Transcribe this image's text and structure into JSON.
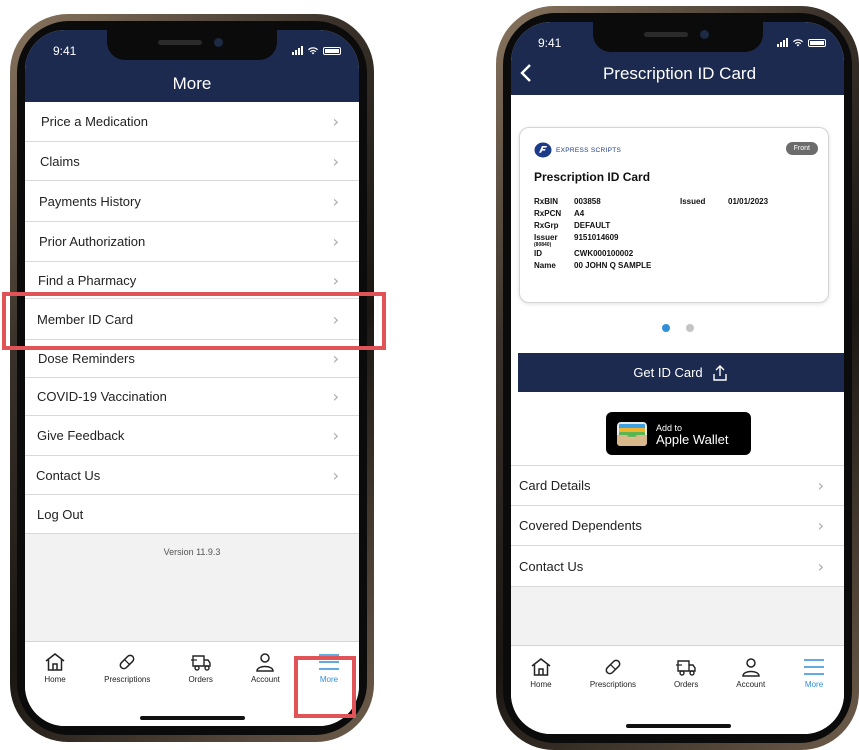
{
  "colors": {
    "navy": "#1b2a4e",
    "accent_blue": "#2f8fd9",
    "highlight_red": "#e05457"
  },
  "left_phone": {
    "time": "9:41",
    "title": "More",
    "menu_items": [
      {
        "label": "Price a Medication"
      },
      {
        "label": "Claims"
      },
      {
        "label": "Payments History"
      },
      {
        "label": "Prior Authorization"
      },
      {
        "label": "Find a Pharmacy"
      },
      {
        "label": "Member ID Card"
      },
      {
        "label": "Dose Reminders"
      },
      {
        "label": "COVID-19 Vaccination"
      },
      {
        "label": "Give Feedback"
      },
      {
        "label": "Contact Us"
      },
      {
        "label": "Log Out"
      }
    ],
    "version": "Version 11.9.3"
  },
  "right_phone": {
    "time": "9:41",
    "title": "Prescription ID Card",
    "card": {
      "brand": "EXPRESS SCRIPTS",
      "side_badge": "Front",
      "heading": "Prescription ID Card",
      "rxbin_label": "RxBIN",
      "rxbin_value": "003858",
      "issued_label": "Issued",
      "issued_value": "01/01/2023",
      "rxpcn_label": "RxPCN",
      "rxpcn_value": "A4",
      "rxgrp_label": "RxGrp",
      "rxgrp_value": "DEFAULT",
      "issuer_label": "Issuer",
      "issuer_sub": "(80840)",
      "issuer_value": "9151014609",
      "id_label": "ID",
      "id_value": "CWK000100002",
      "name_label": "Name",
      "name_value": "00 JOHN Q SAMPLE"
    },
    "get_id_card": "Get ID Card",
    "wallet_line1": "Add to",
    "wallet_line2": "Apple Wallet",
    "list": [
      {
        "label": "Card Details"
      },
      {
        "label": "Covered Dependents"
      },
      {
        "label": "Contact Us"
      }
    ]
  },
  "tabs": [
    {
      "label": "Home",
      "icon": "home-icon"
    },
    {
      "label": "Prescriptions",
      "icon": "pill-icon"
    },
    {
      "label": "Orders",
      "icon": "truck-icon"
    },
    {
      "label": "Account",
      "icon": "person-icon"
    },
    {
      "label": "More",
      "icon": "menu-icon"
    }
  ]
}
